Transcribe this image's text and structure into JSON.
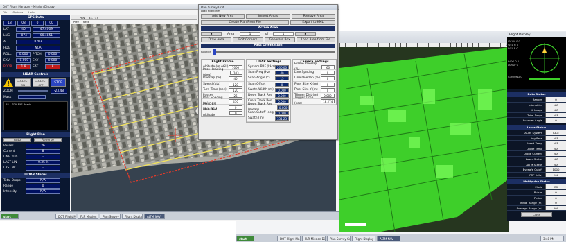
{
  "left_window": {
    "title": "DOT Flight Manager - Mission Display",
    "menu": [
      "File",
      "Options",
      "Help"
    ],
    "gps": {
      "header": "GPS Data",
      "top_boxes": [
        "18",
        "08",
        "0",
        "00"
      ],
      "rows": [
        {
          "label": "LAT",
          "v1": "40",
          "v2": "47.4009"
        },
        {
          "label": "LNG",
          "v1": "-074",
          "v2": "00.4851"
        },
        {
          "label": "ALT",
          "v1": "8703",
          "v2": ""
        },
        {
          "label": "HDG",
          "v1": "NCA",
          "v2": ""
        }
      ],
      "attitude": [
        {
          "label": "ROLL",
          "val": "0.000",
          "label2": "PITCH",
          "val2": "0.000"
        },
        {
          "label": "EXV",
          "val": "-0.000",
          "label2": "EXY",
          "val2": "0.000"
        },
        {
          "label": "PDOP",
          "val": "1.8",
          "label2": "SAT",
          "val2": "8"
        }
      ]
    },
    "lidar_control": {
      "header": "LIDAR Controls",
      "collect_on": "COLLECT ON",
      "collect_off": "COLLECT OFF",
      "stop": "STOP",
      "zoom_label": "ZOOM",
      "zoom_val": "-23.48",
      "mask_label": "Mask",
      "status_text": "AIL - SDK EXE Ready"
    },
    "flight_plan": {
      "header": "Flight Plan",
      "col1": "Auto",
      "col2": "Reverse",
      "rows": [
        {
          "label": "Passes",
          "value": "26"
        },
        {
          "label": "Current",
          "value": "8"
        },
        {
          "label": "LINE XDS",
          "value": "-"
        },
        {
          "label": "LAST LIN",
          "value": "-0.35 %"
        },
        {
          "label": "LAST PCT",
          "value": "-"
        }
      ]
    },
    "lidar_status": {
      "header": "LIDAR Status",
      "rows": [
        {
          "label": "Total Drops",
          "value": "N/A"
        },
        {
          "label": "Range",
          "value": "0"
        },
        {
          "label": "Intensity",
          "value": "N/A"
        }
      ]
    },
    "map_tab": "PLN",
    "map_tab_value": "41.737",
    "map_subtabs": [
      "Prev",
      "Next"
    ]
  },
  "plan_window": {
    "title": "Plan Survey Grid",
    "menu": "Load Flightlines",
    "top_buttons": [
      "Add New Area",
      "Import Areas",
      "Remove Area"
    ],
    "second_row": [
      "Create Plan From File",
      "Export to KML"
    ],
    "active_area_header": "Active Area",
    "nav_left": "◂",
    "area_label": "Area",
    "area_val": "1",
    "of_label": "of",
    "of_val": "1",
    "nav_right": "▸",
    "area_buttons": [
      "Draw Area",
      "Edit Corners",
      "Generate Box",
      "Load Area from File"
    ],
    "pass_orientation": "Pass Orientation",
    "slider_label": "Rotation",
    "flight_profile": {
      "header": "Flight Profile",
      "rows": [
        {
          "label": "Altitude (m AGL)",
          "value": "1000"
        },
        {
          "label": "Pass Heading (deg)",
          "value": "103"
        },
        {
          "label": "Overlap (%)",
          "value": "40"
        },
        {
          "label": "Speed (kts)",
          "value": "120"
        },
        {
          "label": "Turn Time (sec)",
          "value": "120"
        },
        {
          "label": "Passes",
          "value": "26"
        },
        {
          "label": "Pass Spacing (m)",
          "value": "450"
        },
        {
          "label": "Min DEM Altitude",
          "value": "0"
        },
        {
          "label": "Max DEM Altitude",
          "value": "0"
        }
      ]
    },
    "lidar_settings": {
      "header": "LiDAR Settings",
      "rows": [
        {
          "label": "System PRF (kHz)",
          "value": "200.00"
        },
        {
          "label": "Scan Freq (Hz)",
          "value": "40"
        },
        {
          "label": "Scan Angle (°)",
          "value": "15"
        },
        {
          "label": "Scan Offset",
          "value": "0"
        },
        {
          "label": "Swath Width (m)",
          "value": "0.000"
        },
        {
          "label": "Down Track Res",
          "value": "0.000"
        },
        {
          "label": "Cross Track Res",
          "value": "0.000"
        },
        {
          "label": "Down Track Res (mean)",
          "value": "0.000"
        },
        {
          "label": "Scan Cutoff (deg)",
          "value": "0.000"
        },
        {
          "label": "Swath (m)",
          "value": "331.23"
        }
      ]
    },
    "camera_settings": {
      "header": "Camera Settings",
      "rows": [
        {
          "label": "Frame Overlap (%)",
          "value": "60"
        },
        {
          "label": "Line Spacing",
          "value": "0"
        },
        {
          "label": "Line Overlap (%)",
          "value": "0"
        },
        {
          "label": "Pixel Size X (m)",
          "value": "0"
        },
        {
          "label": "Pixel Size Y (m)",
          "value": "0"
        },
        {
          "label": "Trigger Dist (m)",
          "value": "0.000"
        },
        {
          "label": "Trigger Time (sec)",
          "value": "18.274"
        }
      ]
    }
  },
  "right_window": {
    "title": "Flight Display",
    "readouts": [
      {
        "label": "SCAN",
        "value": "0.0"
      },
      {
        "label": "VEL N",
        "value": "0"
      },
      {
        "label": "VEL E",
        "value": "0"
      },
      {
        "label": "HDG",
        "value": "0.0"
      },
      {
        "label": "AIRSP",
        "value": "0"
      },
      {
        "label": "GROUND",
        "value": "0"
      }
    ],
    "data_status": {
      "header": "Data Status",
      "rows": [
        {
          "label": "Ranges",
          "value": "0"
        },
        {
          "label": "Intensities",
          "value": "N/A"
        },
        {
          "label": "% Usage",
          "value": "N/A"
        },
        {
          "label": "Total Drops",
          "value": "N/A"
        },
        {
          "label": "Scanner Angle",
          "value": "0"
        }
      ]
    },
    "laser_status": {
      "header": "Laser Status",
      "rows": [
        {
          "label": "ALTM System",
          "value": "IDLE"
        },
        {
          "label": "Avg Rate",
          "value": "N/A"
        },
        {
          "label": "Head Temp",
          "value": "N/A"
        },
        {
          "label": "Diode Temp",
          "value": "N/A"
        },
        {
          "label": "Diode Current",
          "value": "N/A"
        },
        {
          "label": "Laser Status",
          "value": "N/A"
        },
        {
          "label": "ALTM Status",
          "value": "N/A"
        },
        {
          "label": "Eyesafe Cutoff",
          "value": "1000"
        },
        {
          "label": "PRF (kHz)",
          "value": "200"
        }
      ]
    },
    "multipulse_status": {
      "header": "Multipulse Status",
      "rows": [
        {
          "label": "Mode",
          "value": "Off"
        },
        {
          "label": "Pulses",
          "value": "0"
        },
        {
          "label": "Period",
          "value": "0"
        },
        {
          "label": "Initial Range (m)",
          "value": "0"
        },
        {
          "label": "Average Range (m)",
          "value": "200"
        }
      ]
    },
    "close_label": "Close"
  },
  "taskbar_left": {
    "start": "start",
    "items": [
      "DOT Flight Ma...",
      "FLR Mission Display",
      "Plan Survey Grid",
      "Flight Display",
      "ALTM NAV"
    ]
  },
  "taskbar_right": {
    "start": "start",
    "items": [
      "DOT Flight Ma...",
      "FLR Mission Display",
      "Plan Survey Grid",
      "Flight Display",
      "ALTM NAV"
    ],
    "clock": "3:48 PM"
  },
  "colors": {
    "panel_navy": "#1c2f63",
    "lidar_green": "#3ecf2a",
    "plan_red": "#e23b2b",
    "flightline_yellow": "#f2e35a"
  }
}
